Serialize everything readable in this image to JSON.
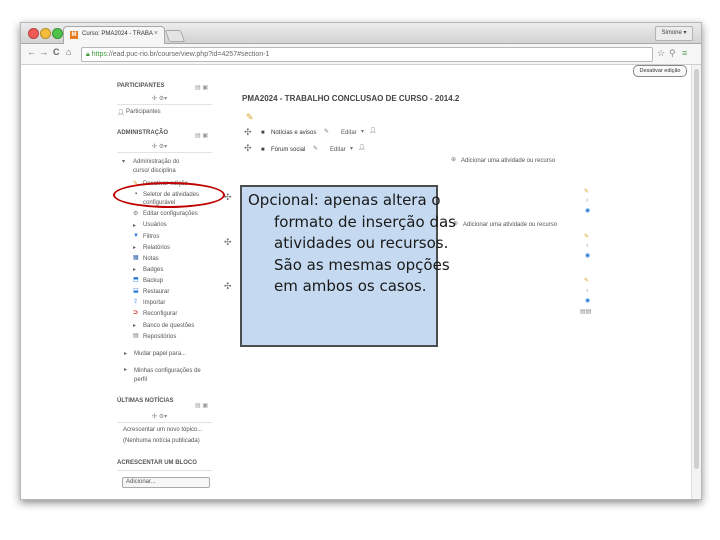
{
  "browser": {
    "tab_title": "Curso: PMA2024 - TRABA",
    "tab_close": "×",
    "favicon_text": "M",
    "user_button": "Simone ▾",
    "nav": {
      "back": "←",
      "forward": "→",
      "reload": "C",
      "home": "⌂"
    },
    "url_scheme": "https",
    "url_rest": "://ead.puc-rio.br/course/view.php?id=4257#section-1",
    "star": "☆",
    "colors": {
      "secure": "#3a9a3a",
      "tab_favicon": "#e57a1e"
    }
  },
  "page": {
    "admin_button": "Desativar edição",
    "course_title": "PMA2024 - TRABALHO CONCLUSAO DE CURSO - 2014.2"
  },
  "blocks": {
    "participants": {
      "title": "PARTICIPANTES",
      "link": "Participantes"
    },
    "admin": {
      "title": "ADMINISTRAÇÃO",
      "items": [
        "Administração do curso/ disciplina",
        "Desativar edição",
        "Seletor de atividades configurável",
        "Editar configurações",
        "Usuários",
        "Filtros",
        "Relatórios",
        "Notas",
        "Badges",
        "Backup",
        "Restaurar",
        "Importar",
        "Reconfigurar",
        "Banco de questões",
        "Repositórios",
        "Mudar papel para...",
        "Minhas configurações de perfil"
      ]
    },
    "news": {
      "title": "ÚLTIMAS NOTÍCIAS",
      "add": "Acrescentar um novo tópico...",
      "none": "(Nenhuma notícia publicada)"
    },
    "add_block": {
      "title": "ACRESCENTAR UM BLOCO",
      "select": "Adicionar..."
    }
  },
  "section0": {
    "activities": [
      {
        "name": "Notícias e avisos",
        "edit": "Editar"
      },
      {
        "name": "Fórum social",
        "edit": "Editar"
      }
    ],
    "add_activity": "Adicionar uma atividade ou recurso"
  },
  "section1": {
    "add_activity": "Adicionar uma atividade ou recurso"
  },
  "callout": {
    "text": "Opcional: apenas altera o formato de inserção das atividades ou recursos. São as mesmas opções em ambos os casos.",
    "bg_color": "#c5d9f0"
  },
  "highlight": {
    "color": "#c00000"
  },
  "icons": [
    "close-icon",
    "back-icon",
    "forward-icon",
    "reload-icon",
    "home-icon",
    "lock-icon",
    "star-icon",
    "move-icon",
    "pencil-icon",
    "eye-icon",
    "forum-icon",
    "user-icon",
    "add-activity-icon",
    "plus-icon"
  ]
}
